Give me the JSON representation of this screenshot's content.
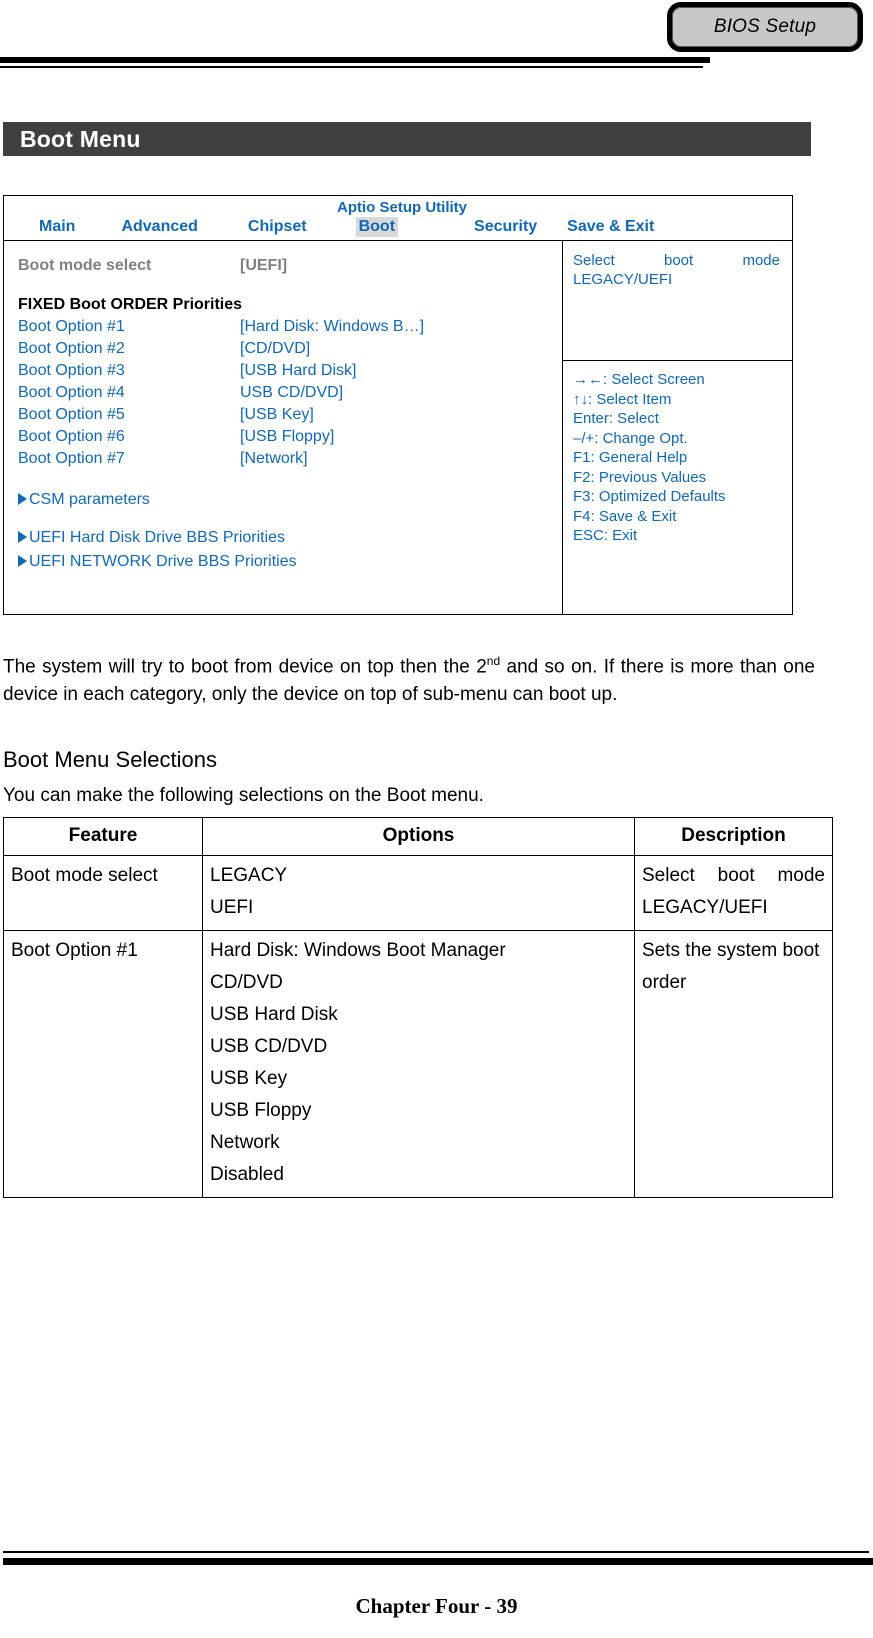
{
  "header": {
    "tab_label": "BIOS Setup"
  },
  "section": {
    "title": "Boot Menu"
  },
  "bios_screen": {
    "app_title": "Aptio Setup Utility",
    "tabs": [
      {
        "label": "Main",
        "selected": false
      },
      {
        "label": "Advanced",
        "selected": false
      },
      {
        "label": "Chipset",
        "selected": false
      },
      {
        "label": "Boot",
        "selected": true
      },
      {
        "label": "Security",
        "selected": false
      },
      {
        "label": "Save & Exit",
        "selected": false
      }
    ],
    "boot_mode": {
      "label": "Boot mode select",
      "value": "[UEFI]"
    },
    "fixed_order_heading": "FIXED Boot ORDER Priorities",
    "boot_options": [
      {
        "label": "Boot Option #1",
        "value": "[Hard Disk: Windows B…]"
      },
      {
        "label": "Boot Option #2",
        "value": "[CD/DVD]"
      },
      {
        "label": "Boot Option #3",
        "value": "[USB Hard Disk]"
      },
      {
        "label": "Boot Option #4",
        "value": "USB CD/DVD]"
      },
      {
        "label": "Boot Option #5",
        "value": "[USB Key]"
      },
      {
        "label": "Boot Option #6",
        "value": "[USB Floppy]"
      },
      {
        "label": "Boot Option #7",
        "value": "[Network]"
      }
    ],
    "submenus": [
      {
        "label": "CSM parameters"
      },
      {
        "label": "UEFI Hard Disk Drive BBS Priorities"
      },
      {
        "label": "UEFI NETWORK Drive BBS Priorities"
      }
    ],
    "help_description": "Select boot mode LEGACY/UEFI",
    "help_keys": [
      "→←: Select Screen",
      "↑↓: Select Item",
      "Enter: Select",
      "–/+: Change Opt.",
      "F1: General Help",
      "F2: Previous Values",
      "F3: Optimized Defaults",
      "F4: Save & Exit",
      "ESC: Exit"
    ],
    "accent_color": "#1268b3",
    "dimmed_color": "#808080",
    "selected_tab_bg": "#d9d9d9"
  },
  "body": {
    "paragraph_part1": "The system will try to boot from device on top then the 2",
    "paragraph_sup": "nd",
    "paragraph_part2": " and so on. If there is more than one device in each category, only the device on top of sub-menu can boot up.",
    "subheading": "Boot Menu Selections",
    "lead_in": "You can make the following selections on the Boot menu."
  },
  "selections_table": {
    "headers": [
      "Feature",
      "Options",
      "Description"
    ],
    "rows": [
      {
        "feature": "Boot mode select",
        "options": [
          "LEGACY",
          "UEFI"
        ],
        "description": "Select boot mode LEGACY/UEFI"
      },
      {
        "feature": "Boot Option #1",
        "options": [
          "Hard Disk: Windows Boot Manager",
          "CD/DVD",
          "USB Hard Disk",
          "USB CD/DVD",
          "USB Key",
          "USB Floppy",
          "Network",
          "Disabled"
        ],
        "description": "Sets the system boot order"
      }
    ]
  },
  "footer": {
    "text": "Chapter Four - 39"
  }
}
